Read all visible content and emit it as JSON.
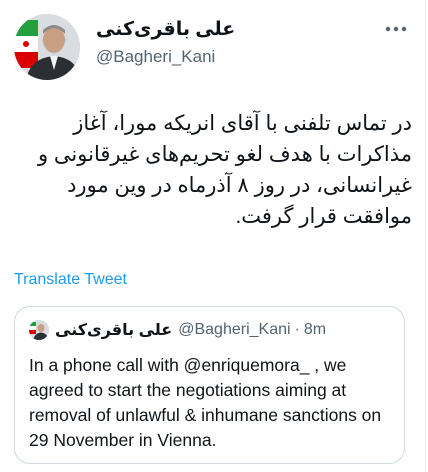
{
  "author": {
    "display_name": "علی باقری‌کنی",
    "handle": "@Bagheri_Kani",
    "avatar_icon": "profile-photo-icon"
  },
  "more_icon": "more-options-icon",
  "tweet": {
    "text": "در تماس تلفنی با آقای انریکه مورا، آغاز مذاکرات با هدف لغو تحریم‌های غیرقانونی و غیرانسانی، در روز ۸ آذرماه در وین مورد موافقت قرار گرفت.",
    "translate_label": "Translate Tweet"
  },
  "quoted_tweet": {
    "display_name": "علی باقری‌کنی",
    "handle": "@Bagheri_Kani",
    "separator": "·",
    "time": "8m",
    "text": "In a phone call with @enriquemora_ , we agreed to start the negotiations aiming at removal of unlawful & inhumane sanctions on 29 November in Vienna."
  },
  "colors": {
    "text": "#0f1419",
    "muted": "#536471",
    "link": "#1d9bf0",
    "border": "#cfd9de",
    "flag_green": "#239f40",
    "flag_red": "#da0000"
  }
}
